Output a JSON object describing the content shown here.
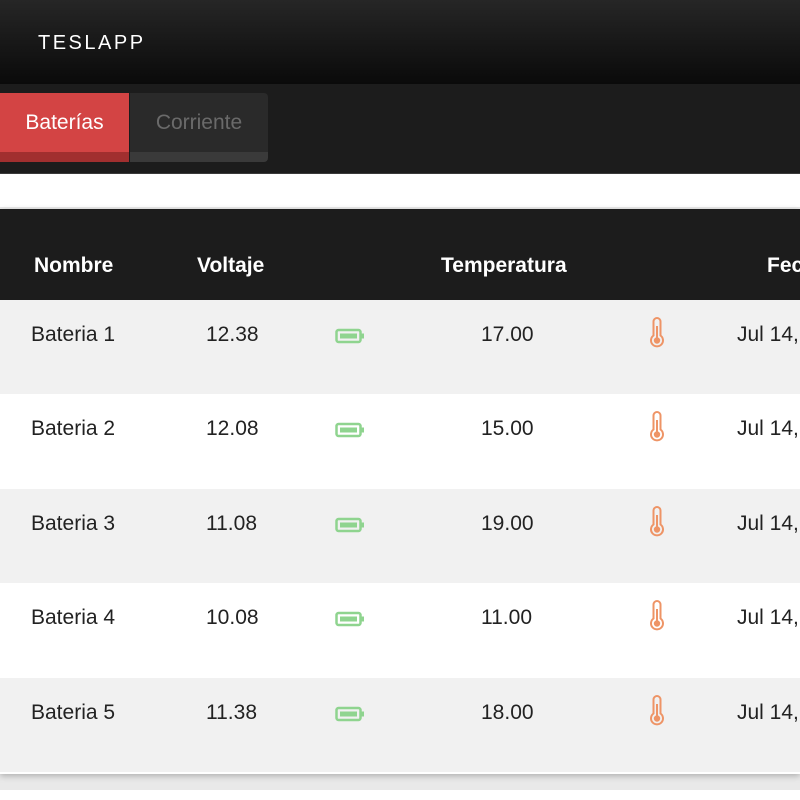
{
  "app": {
    "brand": "TESLAPP"
  },
  "tabs": [
    {
      "label": "Baterías",
      "active": true
    },
    {
      "label": "Corriente",
      "active": false
    }
  ],
  "table": {
    "headers": {
      "nombre": "Nombre",
      "voltaje": "Voltaje",
      "temperatura": "Temperatura",
      "fecha": "Fec"
    },
    "rows": [
      {
        "name": "Bateria 1",
        "voltage": "12.38",
        "temperature": "17.00",
        "date": "Jul 14,"
      },
      {
        "name": "Bateria 2",
        "voltage": "12.08",
        "temperature": "15.00",
        "date": "Jul 14,"
      },
      {
        "name": "Bateria 3",
        "voltage": "11.08",
        "temperature": "19.00",
        "date": "Jul 14,"
      },
      {
        "name": "Bateria 4",
        "voltage": "10.08",
        "temperature": "11.00",
        "date": "Jul 14,"
      },
      {
        "name": "Bateria 5",
        "voltage": "11.38",
        "temperature": "18.00",
        "date": "Jul 14,"
      }
    ],
    "icons": {
      "battery": "battery-icon",
      "thermometer": "thermometer-icon"
    }
  },
  "colors": {
    "accent": "#d34444",
    "battery": "#8fd48f",
    "thermometer": "#ee9466",
    "header_bg": "#1c1c1c"
  }
}
